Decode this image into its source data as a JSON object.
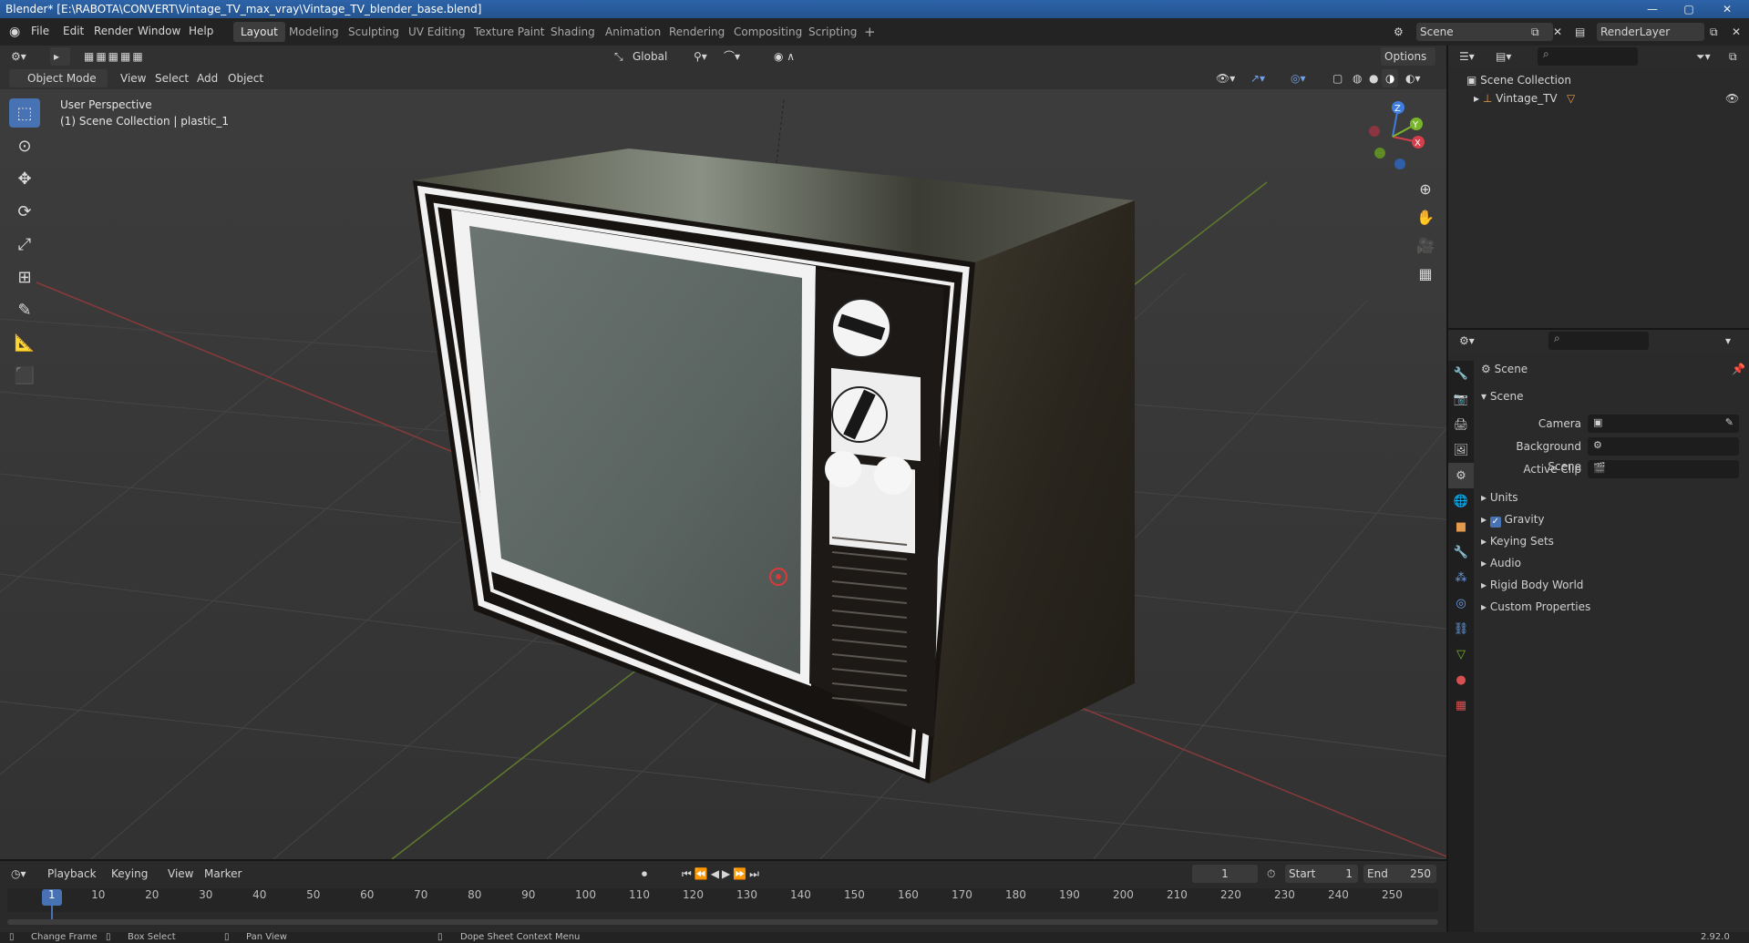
{
  "window": {
    "title": "Blender* [E:\\RABOTA\\CONVERT\\Vintage_TV_max_vray\\Vintage_TV_blender_base.blend]",
    "minimize": "—",
    "maximize": "▢",
    "close": "✕"
  },
  "menu": [
    "File",
    "Edit",
    "Render",
    "Window",
    "Help"
  ],
  "workspaces": [
    "Layout",
    "Modeling",
    "Sculpting",
    "UV Editing",
    "Texture Paint",
    "Shading",
    "Animation",
    "Rendering",
    "Compositing",
    "Scripting"
  ],
  "active_workspace": "Layout",
  "add_workspace": "+",
  "scene_selector": "Scene",
  "render_layer_selector": "RenderLayer",
  "viewport_header": {
    "mode": "Object Mode",
    "menus": [
      "View",
      "Select",
      "Add",
      "Object"
    ],
    "transform_orientation": "Global",
    "options_label": "Options"
  },
  "viewport": {
    "perspective_label": "User Perspective",
    "collection_label": "(1) Scene Collection | plastic_1",
    "gizmo_axes": {
      "x": "X",
      "y": "Y",
      "z": "Z"
    }
  },
  "outliner": {
    "root": "Scene Collection",
    "items": [
      {
        "label": "Vintage_TV"
      }
    ]
  },
  "properties": {
    "header": "Scene",
    "panel_title": "Scene",
    "fields": [
      {
        "label": "Camera",
        "value": ""
      },
      {
        "label": "Background Scene",
        "value": ""
      },
      {
        "label": "Active Clip",
        "value": ""
      }
    ],
    "sections": [
      "Units",
      "Gravity",
      "Keying Sets",
      "Audio",
      "Rigid Body World",
      "Custom Properties"
    ],
    "gravity_checked": true
  },
  "timeline": {
    "menus": [
      "Playback",
      "Keying",
      "View",
      "Marker"
    ],
    "current_frame": "1",
    "start_label": "Start",
    "start": "1",
    "end_label": "End",
    "end": "250",
    "ticks": [
      "1",
      "10",
      "20",
      "30",
      "40",
      "50",
      "60",
      "70",
      "80",
      "90",
      "100",
      "110",
      "120",
      "130",
      "140",
      "150",
      "160",
      "170",
      "180",
      "190",
      "200",
      "210",
      "220",
      "230",
      "240",
      "250"
    ]
  },
  "statusbar": {
    "items": [
      "Change Frame",
      "Box Select",
      "Pan View",
      "Dope Sheet Context Menu"
    ],
    "version": "2.92.0"
  },
  "colors": {
    "accent": "#4772b3",
    "title_bar": "#2b5d9e",
    "grid_red": "#a03c3c",
    "grid_green": "#6d8a2c"
  }
}
